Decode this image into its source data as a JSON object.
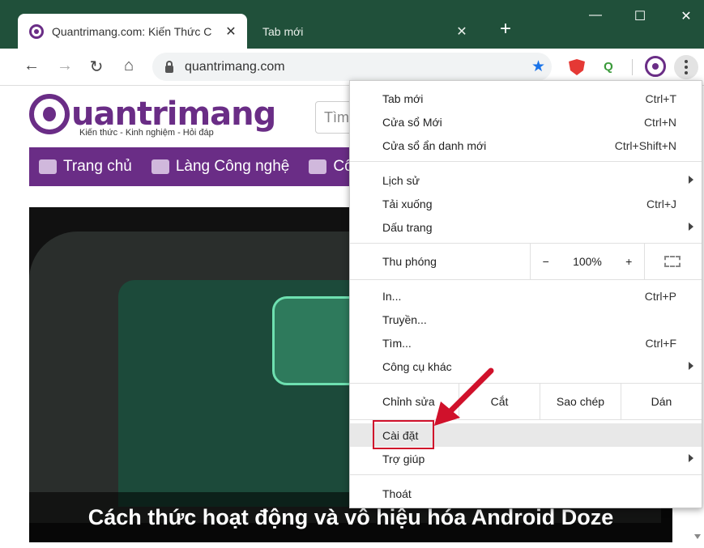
{
  "tabs": [
    {
      "title": "Quantrimang.com: Kiến Thức C",
      "close": "✕"
    },
    {
      "title": "Tab mới",
      "close": "✕"
    }
  ],
  "new_tab": "+",
  "window_controls": {
    "minimize": "—",
    "maximize": "☐",
    "close": "✕"
  },
  "toolbar": {
    "back": "←",
    "forward": "→",
    "reload": "↻",
    "home": "⌂",
    "url": "quantrimang.com",
    "star": "★",
    "ext_q": "Q"
  },
  "site": {
    "logo": "uantrimang",
    "tagline": "Kiến thức - Kinh nghiệm - Hỏi đáp",
    "search_placeholder": "Tìm",
    "nav": [
      "Trang chủ",
      "Làng Công nghệ",
      "Cô"
    ],
    "hero_title": "Cách thức hoạt động và vô hiệu hóa Android Doze"
  },
  "menu": {
    "items": [
      {
        "label": "Tab mới",
        "shortcut": "Ctrl+T"
      },
      {
        "label": "Cửa sổ Mới",
        "shortcut": "Ctrl+N"
      },
      {
        "label": "Cửa sổ ẩn danh mới",
        "shortcut": "Ctrl+Shift+N"
      },
      {
        "label": "Lịch sử",
        "shortcut": ""
      },
      {
        "label": "Tải xuống",
        "shortcut": "Ctrl+J"
      },
      {
        "label": "Dấu trang",
        "shortcut": ""
      },
      {
        "label": "In...",
        "shortcut": "Ctrl+P"
      },
      {
        "label": "Truyền...",
        "shortcut": ""
      },
      {
        "label": "Tìm...",
        "shortcut": "Ctrl+F"
      },
      {
        "label": "Công cụ khác",
        "shortcut": ""
      },
      {
        "label": "Cài đặt",
        "shortcut": ""
      },
      {
        "label": "Trợ giúp",
        "shortcut": ""
      },
      {
        "label": "Thoát",
        "shortcut": ""
      }
    ],
    "zoom": {
      "label": "Thu phóng",
      "minus": "−",
      "value": "100%",
      "plus": "+"
    },
    "edit": {
      "label": "Chỉnh sửa",
      "cut": "Cắt",
      "copy": "Sao chép",
      "paste": "Dán"
    }
  },
  "colors": {
    "accent": "#6a2d86",
    "titlebar": "#20503a",
    "highlight": "#d0112b"
  }
}
